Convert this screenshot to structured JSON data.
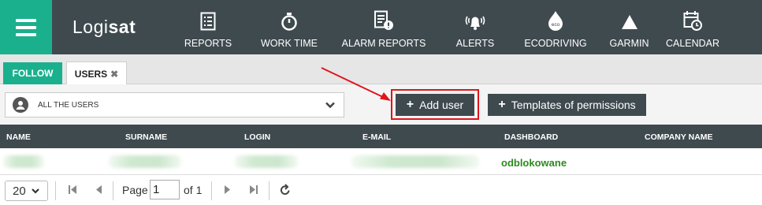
{
  "app": {
    "logo_light": "Logi",
    "logo_bold": "sat"
  },
  "nav": [
    {
      "label": "REPORTS",
      "icon": "reports-icon"
    },
    {
      "label": "WORK TIME",
      "icon": "stopwatch-icon"
    },
    {
      "label": "ALARM REPORTS",
      "icon": "alarm-report-icon"
    },
    {
      "label": "ALERTS",
      "icon": "bell-icon"
    },
    {
      "label": "ECODRIVING",
      "icon": "eco-drop-icon"
    },
    {
      "label": "GARMIN",
      "icon": "triangle-icon"
    },
    {
      "label": "CALENDAR",
      "icon": "calendar-icon"
    }
  ],
  "tabs": {
    "follow": "FOLLOW",
    "users": "USERS",
    "close": "✖"
  },
  "toolbar": {
    "user_filter": "ALL THE USERS",
    "add_user": "Add user",
    "templates": "Templates of permissions"
  },
  "table": {
    "columns": [
      "NAME",
      "SURNAME",
      "LOGIN",
      "E-MAIL",
      "DASHBOARD",
      "COMPANY NAME"
    ],
    "rows": [
      {
        "dashboard": "odblokowane"
      }
    ]
  },
  "pager": {
    "page_size": "20",
    "page_label": "Page",
    "page_value": "1",
    "of_label": "of 1"
  },
  "colors": {
    "accent": "#1bb08d",
    "dark": "#3f4a4f",
    "highlight": "#e0141b",
    "status_green": "#2d8a1e"
  }
}
